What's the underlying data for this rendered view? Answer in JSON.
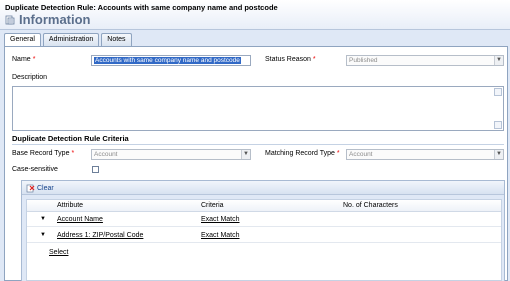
{
  "header": {
    "title": "Duplicate Detection Rule: Accounts with same company name and postcode",
    "entity": "Information",
    "icon": "form-icon"
  },
  "tabs": [
    {
      "label": "General",
      "active": true
    },
    {
      "label": "Administration",
      "active": false
    },
    {
      "label": "Notes",
      "active": false
    }
  ],
  "form": {
    "name_label": "Name",
    "name_value": "Accounts with same company name and postcode",
    "status_label": "Status Reason",
    "status_value": "Published",
    "description_label": "Description",
    "required_marker": "*"
  },
  "criteria": {
    "section_title": "Duplicate Detection Rule Criteria",
    "base_label": "Base Record Type",
    "base_value": "Account",
    "matching_label": "Matching Record Type",
    "matching_value": "Account",
    "case_label": "Case-sensitive",
    "case_checked": false
  },
  "grid": {
    "clear_label": "Clear",
    "columns": [
      "Attribute",
      "Criteria",
      "No. of Characters"
    ],
    "rows": [
      {
        "attribute": "Account Name",
        "criteria": "Exact Match",
        "chars": ""
      },
      {
        "attribute": "Address 1: ZIP/Postal Code",
        "criteria": "Exact Match",
        "chars": ""
      }
    ],
    "select_label": "Select"
  },
  "colors": {
    "header_entity": "#5b6f8c",
    "selection": "#3169c6",
    "required": "#ee0000",
    "background": "#dfe8f6"
  }
}
